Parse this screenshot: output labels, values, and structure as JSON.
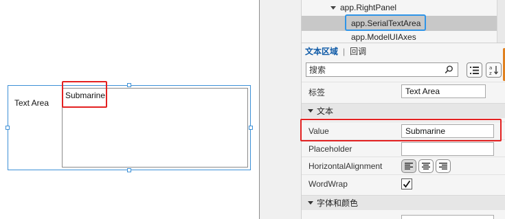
{
  "canvas": {
    "component_label": "Text Area",
    "textarea_value": "Submarine"
  },
  "tree": {
    "items": [
      {
        "label": "app.RightPanel"
      },
      {
        "label": "app.SerialTextArea"
      },
      {
        "label": "app.ModelUIAxes"
      }
    ]
  },
  "tabs": {
    "active": "文本区域",
    "other": "回调"
  },
  "search": {
    "placeholder": "搜索"
  },
  "properties": {
    "label_row": {
      "label": "标签",
      "value": "Text Area"
    },
    "section_text": "文本",
    "value_row": {
      "label": "Value",
      "value": "Submarine"
    },
    "placeholder_row": {
      "label": "Placeholder",
      "value": ""
    },
    "halign_row": {
      "label": "HorizontalAlignment"
    },
    "wordwrap_row": {
      "label": "WordWrap"
    },
    "section_font": "字体和颜色"
  },
  "icons": {
    "search": "search-icon",
    "categorize": "list-categorize-icon",
    "sort": "sort-az-icon",
    "align_left": "align-left-icon",
    "align_center": "align-center-icon",
    "align_right": "align-right-icon",
    "checkbox": "check-icon"
  },
  "colors": {
    "selection_frame": "#3b8fd6",
    "highlight_red": "#e32020",
    "highlight_blue": "#2e94e8",
    "tab_active": "#0e5aa7",
    "accent_orange": "#e0801f"
  }
}
